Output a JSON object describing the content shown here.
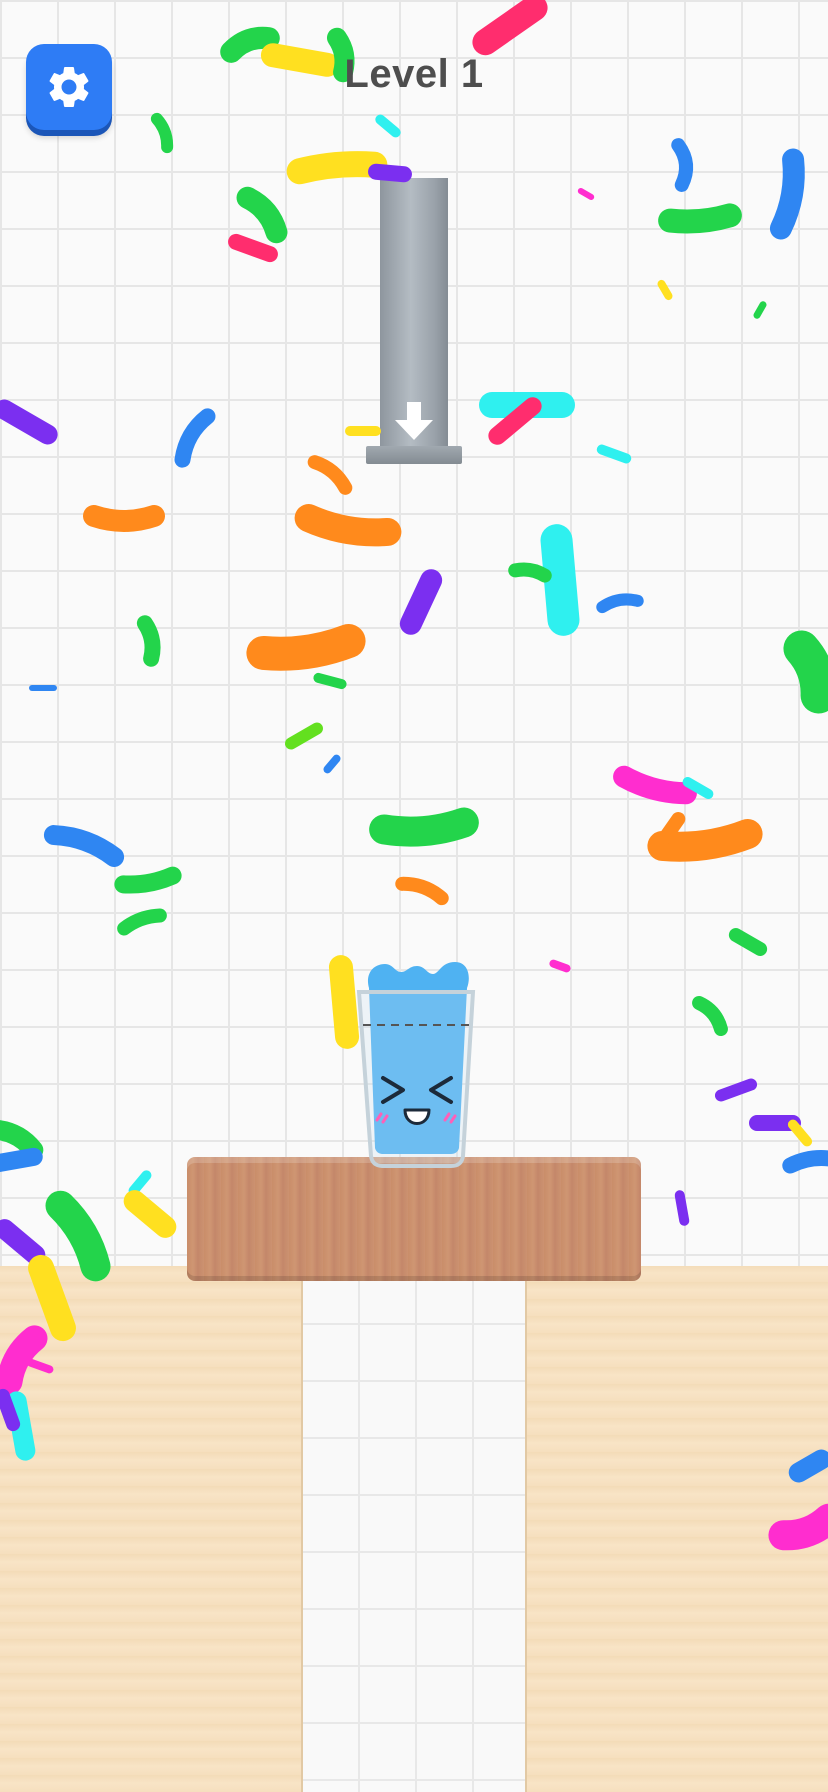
{
  "hud": {
    "level_text": "Level 1",
    "settings_icon": "gear-icon"
  },
  "pipe": {
    "icon": "down-arrow-icon"
  },
  "glass": {
    "face": "laughing-face-icon",
    "water_color": "#4fb2f2"
  },
  "colors": {
    "settings_button": "#2e7cf5",
    "pipe": "#a7afb6",
    "table": "#c98d69",
    "floor": "#f6dfbe",
    "confetti": [
      "#ff2d6e",
      "#23d44b",
      "#ffe020",
      "#2f86f2",
      "#ff8a1c",
      "#7b2ff0",
      "#2ff0ef",
      "#ff2dcf",
      "#63e01f"
    ]
  }
}
